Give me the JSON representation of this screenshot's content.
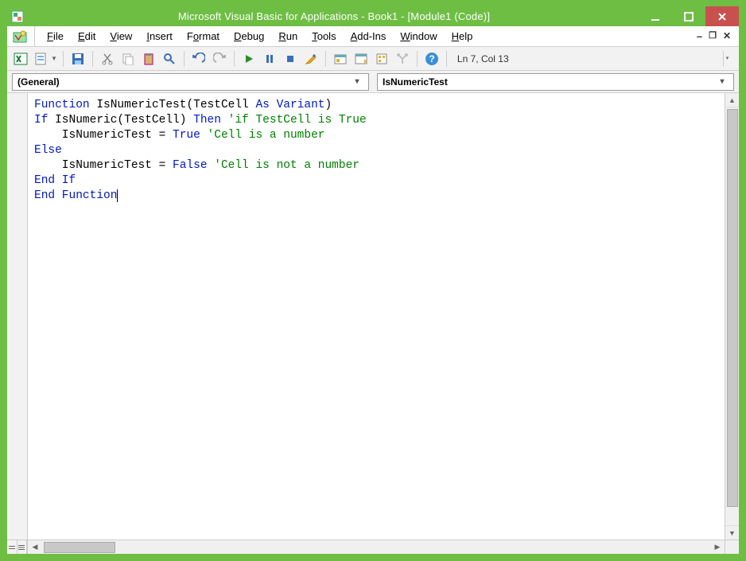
{
  "window": {
    "title": "Microsoft Visual Basic for Applications - Book1 - [Module1 (Code)]"
  },
  "menu": {
    "file": "File",
    "edit": "Edit",
    "view": "View",
    "insert": "Insert",
    "format": "Format",
    "debug": "Debug",
    "run": "Run",
    "tools": "Tools",
    "addins": "Add-Ins",
    "window": "Window",
    "help": "Help"
  },
  "toolbar": {
    "status": "Ln 7, Col 13"
  },
  "dropdowns": {
    "left": "(General)",
    "right": "IsNumericTest"
  },
  "code": {
    "lines": [
      {
        "segments": [
          {
            "t": "Function ",
            "c": "kw"
          },
          {
            "t": "IsNumericTest(TestCell "
          },
          {
            "t": "As Variant",
            "c": "kw"
          },
          {
            "t": ")"
          }
        ]
      },
      {
        "segments": [
          {
            "t": "If ",
            "c": "kw"
          },
          {
            "t": "IsNumeric(TestCell) "
          },
          {
            "t": "Then ",
            "c": "kw"
          },
          {
            "t": "'if TestCell is True",
            "c": "cm"
          }
        ]
      },
      {
        "segments": [
          {
            "t": "    IsNumericTest = "
          },
          {
            "t": "True ",
            "c": "kw"
          },
          {
            "t": "'Cell is a number",
            "c": "cm"
          }
        ]
      },
      {
        "segments": [
          {
            "t": "Else",
            "c": "kw"
          }
        ]
      },
      {
        "segments": [
          {
            "t": "    IsNumericTest = "
          },
          {
            "t": "False ",
            "c": "kw"
          },
          {
            "t": "'Cell is not a number",
            "c": "cm"
          }
        ]
      },
      {
        "segments": [
          {
            "t": "End If",
            "c": "kw"
          }
        ]
      },
      {
        "segments": [
          {
            "t": "End Function",
            "c": "kw",
            "cursor": true
          }
        ]
      }
    ]
  },
  "colors": {
    "accent": "#6FBE44",
    "keyword": "#0018C0",
    "comment": "#008000",
    "close": "#C8504F"
  }
}
